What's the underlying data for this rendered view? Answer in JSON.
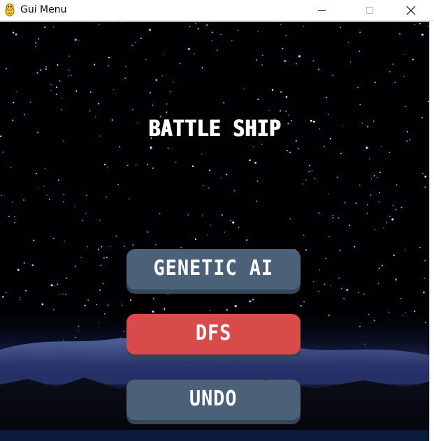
{
  "window": {
    "title": "Gui Menu",
    "icons": [
      "pygame-snake-icon",
      "minimize-icon",
      "maximize-icon",
      "close-icon"
    ]
  },
  "game": {
    "title": "BATTLE SHIP",
    "background": "starfield-night-sky",
    "buttons": [
      {
        "label": "GENETIC AI",
        "color": "#4b6178",
        "shadow": "#36465a"
      },
      {
        "label": "DFS",
        "color": "#d84b4a",
        "shadow": "#34445a"
      },
      {
        "label": "UNDO",
        "color": "#4b6178",
        "shadow": "#36465a"
      }
    ]
  },
  "colors": {
    "sky": "#010103",
    "title_text": "#ffffff"
  }
}
